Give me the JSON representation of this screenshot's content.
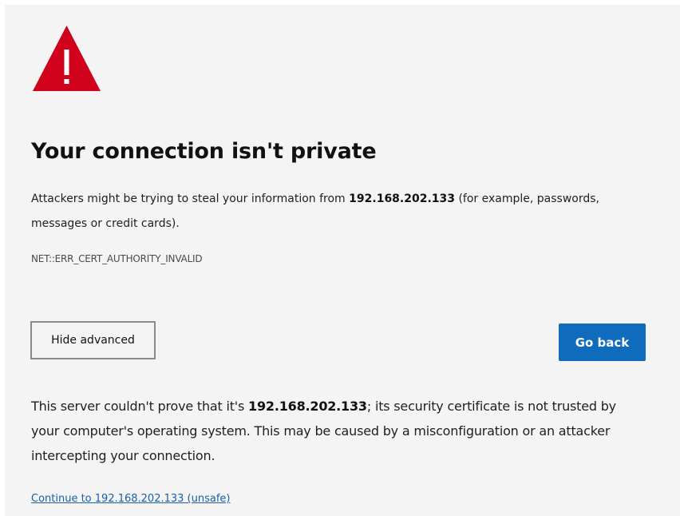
{
  "icon": {
    "name": "warning-icon",
    "color": "#d0021b",
    "glyph_color": "#ffffff"
  },
  "title": "Your connection isn't private",
  "summary": {
    "prefix": "Attackers might be trying to steal your information from ",
    "host": "192.168.202.133",
    "suffix": " (for example, passwords, messages or credit cards)."
  },
  "error_code": "NET::ERR_CERT_AUTHORITY_INVALID",
  "buttons": {
    "advanced_label": "Hide advanced",
    "back_label": "Go back",
    "back_color": "#0f6cbd"
  },
  "details": {
    "prefix": "This server couldn't prove that it's ",
    "host": "192.168.202.133",
    "suffix": "; its security certificate is not trusted by your computer's operating system. This may be caused by a misconfiguration or an attacker intercepting your connection."
  },
  "proceed_link": "Continue to 192.168.202.133 (unsafe)"
}
